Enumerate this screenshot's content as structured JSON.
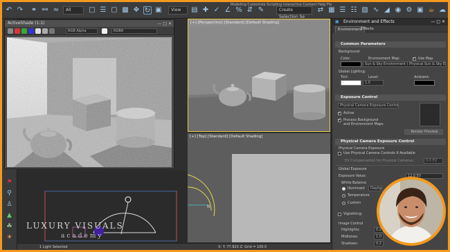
{
  "toolbar": {
    "filter_value": "All",
    "view_value": "View",
    "selection_set": "Create Selection Se",
    "menu_text": "Modeling  Customize  Scripting  Interactive  Content  Help  Flo",
    "accent": "#9ec7e8"
  },
  "activeshade": {
    "title": "ActiveShade (1:1)",
    "channel_select": "RGB Alpha",
    "display_select": "RGBA"
  },
  "viewports": {
    "perspective_label": "[+] [Perspective] [Standard] [Default Shading]",
    "top_label": "[+] [Top] [Standard] [Default Shading]"
  },
  "env": {
    "title": "Environment and Effects",
    "tabs": [
      "Environment",
      "Effects"
    ],
    "common_params": {
      "header": "Common Parameters",
      "background": "Background:",
      "color": "Color:",
      "env_map": "Environment Map:",
      "use_map": "Use Map",
      "map_value": "Sun & Sky Environment  ( Physical Sun & Sky Envir",
      "global_lighting": "Global Lighting:",
      "tint": "Tint:",
      "level": "Level:",
      "level_value": "1.0",
      "ambient": "Ambient:"
    },
    "exposure": {
      "header": "Exposure Control",
      "control_select": "Physical Camera Exposure Control",
      "active": "Active",
      "process_bg": "Process Background",
      "and_env": "and Environment Maps",
      "render_preview": "Render Preview"
    },
    "physical": {
      "header": "Physical Camera Exposure Control",
      "cam_exposure": "Physical Camera Exposure",
      "use_controls": "Use Physical Camera Controls If Available",
      "ev_comp": "EV Compensation for Physical Cameras:",
      "ev_comp_value": "0.0 EV",
      "global_exposure": "Global Exposure",
      "exposure_value": "Exposure Value:",
      "exposure_value_v": "12.0 EV",
      "white_balance": "White Balance",
      "illuminant": "Illuminant",
      "illuminant_value": "Daylight (6",
      "temperature": "Temperature",
      "custom": "Custom",
      "vignetting": "Vignetting:",
      "image_control": "Image Control",
      "highlights": "Highlights:",
      "highlights_value": "0.2",
      "midtones": "Midtones:",
      "midtones_value": "1.0",
      "shadows": "Shadows:",
      "shadows_value": "0.2"
    }
  },
  "status": {
    "selected": "1 Light Selected",
    "coords": "X:   Y:  77.823    Z:   Grid = 100.0"
  },
  "logo": {
    "main": "LUXURY VISUALS",
    "sub": "academy"
  }
}
